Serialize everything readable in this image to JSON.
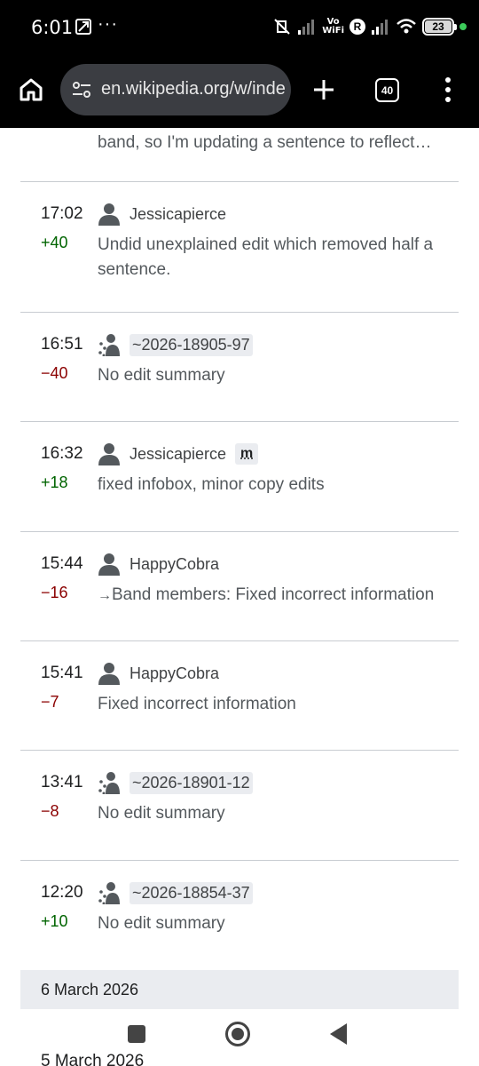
{
  "status_bar": {
    "time": "6:01",
    "dots": "···",
    "wifi_label_top": "Vo",
    "wifi_label_bottom": "WiFi",
    "r_badge": "R",
    "battery": "23"
  },
  "browser": {
    "url": "en.wikipedia.org/w/inde",
    "tab_count": "40"
  },
  "partial_summary": "band, so I'm updating a sentence to reflect…",
  "entries": [
    {
      "time": "17:02",
      "user": "Jessicapierce",
      "user_type": "registered",
      "minor": "",
      "diff": "+40",
      "summary": "Undid unexplained edit which removed half a sentence.",
      "summary_arrow": ""
    },
    {
      "time": "16:51",
      "user": "~2026-18905-97",
      "user_type": "temporary",
      "minor": "",
      "diff": "−40",
      "summary": "No edit summary",
      "summary_arrow": ""
    },
    {
      "time": "16:32",
      "user": "Jessicapierce",
      "user_type": "registered",
      "minor": "m",
      "diff": "+18",
      "summary": "fixed infobox, minor copy edits",
      "summary_arrow": ""
    },
    {
      "time": "15:44",
      "user": "HappyCobra",
      "user_type": "registered",
      "minor": "",
      "diff": "−16",
      "summary": "Band members: Fixed incorrect information",
      "summary_arrow": "→"
    },
    {
      "time": "15:41",
      "user": "HappyCobra",
      "user_type": "registered",
      "minor": "",
      "diff": "−7",
      "summary": "Fixed incorrect information",
      "summary_arrow": ""
    },
    {
      "time": "13:41",
      "user": "~2026-18901-12",
      "user_type": "temporary",
      "minor": "",
      "diff": "−8",
      "summary": "No edit summary",
      "summary_arrow": ""
    },
    {
      "time": "12:20",
      "user": "~2026-18854-37",
      "user_type": "temporary",
      "minor": "",
      "diff": "+10",
      "summary": "No edit summary",
      "summary_arrow": ""
    }
  ],
  "date_header": "6 March 2026",
  "next_date_partial": "5 March 2026",
  "colors": {
    "positive_diff": "#006400",
    "negative_diff": "#8b0000",
    "header_bg": "#eaecf0"
  },
  "icons": {
    "user": "user-icon",
    "temp_user": "temporary-user-icon",
    "home": "home-icon",
    "tune": "site-settings-icon",
    "plus": "new-tab-icon",
    "menu": "more-vert-icon"
  }
}
